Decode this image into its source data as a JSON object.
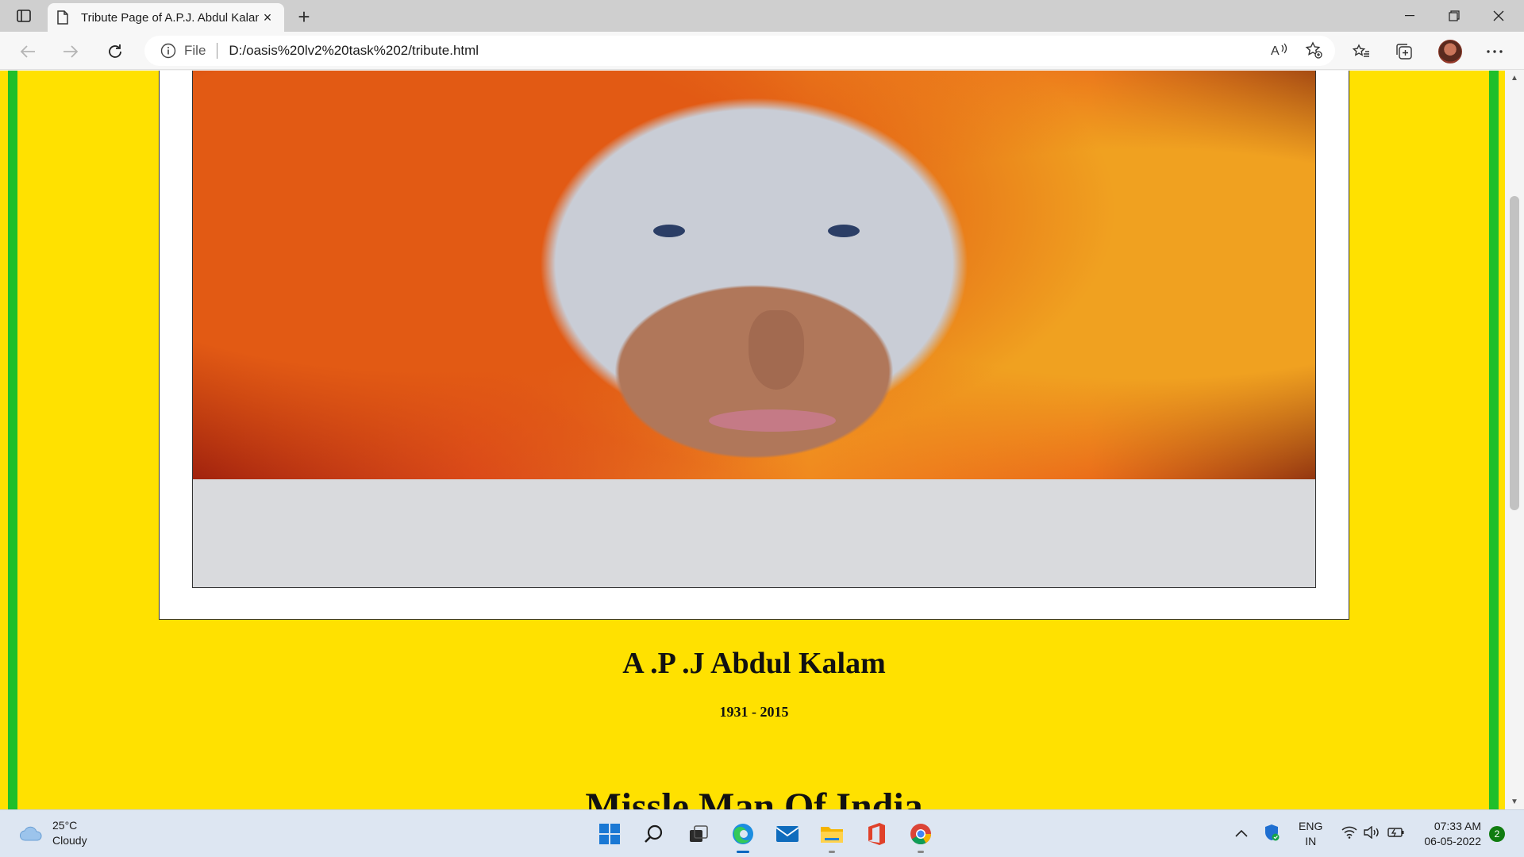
{
  "browser": {
    "tab_title": "Tribute Page of A.P.J. Abdul Kalam",
    "new_tab_symbol": "+",
    "close_tab_symbol": "×",
    "address_prefix": "File",
    "url": "D:/oasis%20lv2%20task%202/tribute.html",
    "window_controls": {
      "minimize": "—",
      "restore": "❐",
      "close": "✕"
    }
  },
  "page": {
    "portrait_alt": "A.P.J. Abdul Kalam portrait",
    "name": "A .P .J Abdul Kalam",
    "years": "1931 - 2015",
    "subheading": "Missle Man Of India",
    "colors": {
      "background": "#ffe100",
      "border_stripe": "#1fbf2a"
    }
  },
  "taskbar": {
    "weather_temp": "25°C",
    "weather_desc": "Cloudy",
    "lang_top": "ENG",
    "lang_bottom": "IN",
    "time": "07:33 AM",
    "date": "06-05-2022",
    "notification_count": "2"
  }
}
